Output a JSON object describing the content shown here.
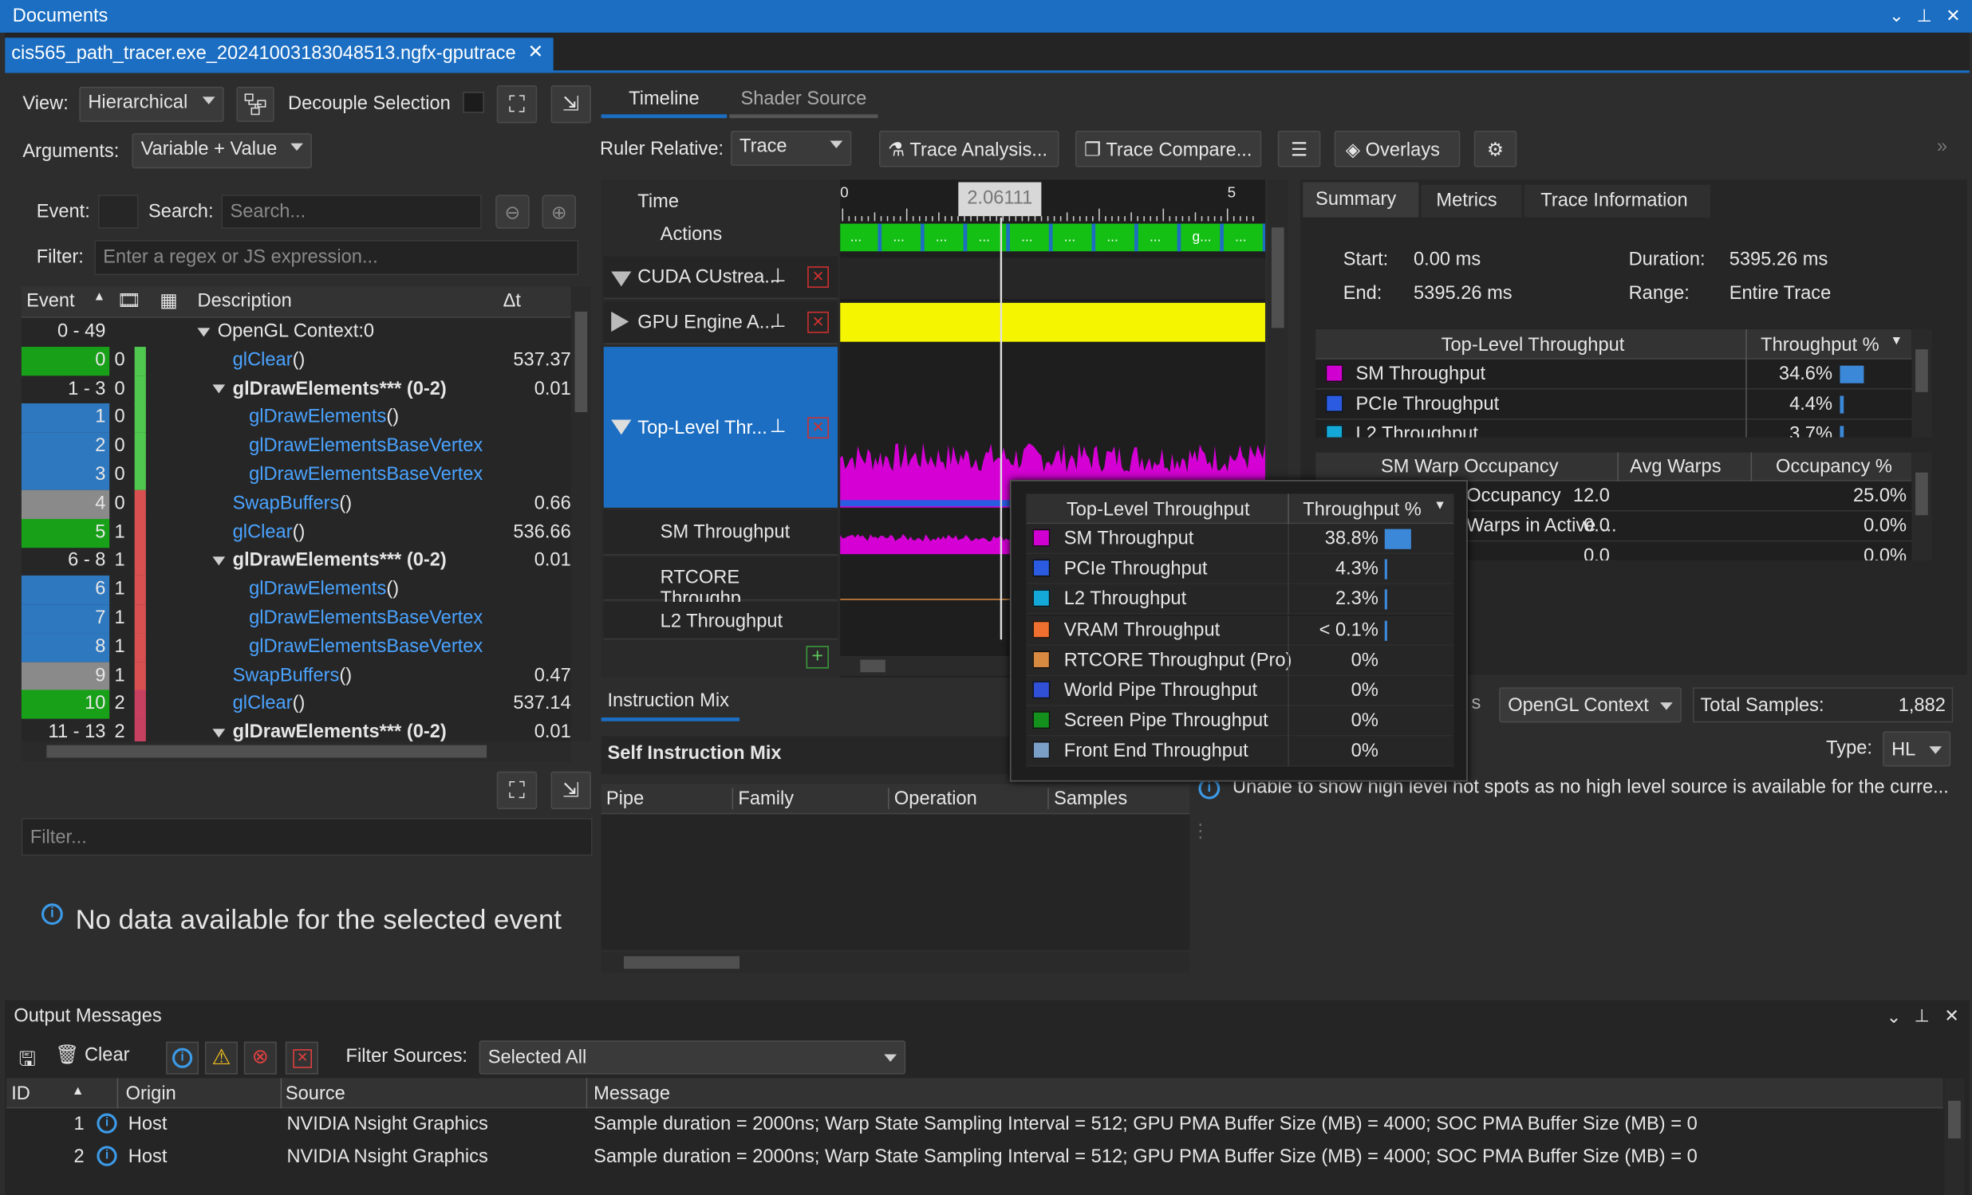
{
  "window": {
    "title": "Documents",
    "doc_tab": "cis565_path_tracer.exe_20241003183048513.ngfx-gputrace"
  },
  "left": {
    "view_label": "View:",
    "view_value": "Hierarchical",
    "decouple_label": "Decouple Selection",
    "arguments_label": "Arguments:",
    "arguments_value": "Variable + Value",
    "event_label": "Event:",
    "search_label": "Search:",
    "search_placeholder": "Search...",
    "filter_label": "Filter:",
    "filter_placeholder": "Enter a regex or JS expression...",
    "columns": {
      "event": "Event",
      "description": "Description",
      "delta": "Δt"
    },
    "rows": [
      {
        "ev": "0 - 49",
        "d": "",
        "desc": "OpenGL Context:0",
        "dt": "",
        "kind": "group0"
      },
      {
        "ev": "0",
        "d": "0",
        "desc": "glClear",
        "paren": "()",
        "dt": "537.37",
        "kind": "green"
      },
      {
        "ev": "1 - 3",
        "d": "0",
        "desc": "glDrawElements*** (0-2)",
        "dt": "0.01",
        "kind": "group"
      },
      {
        "ev": "1",
        "d": "0",
        "desc": "glDrawElements",
        "paren": "()",
        "dt": "",
        "kind": "blue"
      },
      {
        "ev": "2",
        "d": "0",
        "desc": "glDrawElementsBaseVertex",
        "dt": "",
        "kind": "blue"
      },
      {
        "ev": "3",
        "d": "0",
        "desc": "glDrawElementsBaseVertex",
        "dt": "",
        "kind": "blue"
      },
      {
        "ev": "4",
        "d": "0",
        "desc": "SwapBuffers",
        "paren": "()",
        "dt": "0.66",
        "kind": "gray"
      },
      {
        "ev": "5",
        "d": "1",
        "desc": "glClear",
        "paren": "()",
        "dt": "536.66",
        "kind": "green"
      },
      {
        "ev": "6 - 8",
        "d": "1",
        "desc": "glDrawElements*** (0-2)",
        "dt": "0.01",
        "kind": "group"
      },
      {
        "ev": "6",
        "d": "1",
        "desc": "glDrawElements",
        "paren": "()",
        "dt": "",
        "kind": "blue"
      },
      {
        "ev": "7",
        "d": "1",
        "desc": "glDrawElementsBaseVertex",
        "dt": "",
        "kind": "blue"
      },
      {
        "ev": "8",
        "d": "1",
        "desc": "glDrawElementsBaseVertex",
        "dt": "",
        "kind": "blue"
      },
      {
        "ev": "9",
        "d": "1",
        "desc": "SwapBuffers",
        "paren": "()",
        "dt": "0.47",
        "kind": "gray"
      },
      {
        "ev": "10",
        "d": "2",
        "desc": "glClear",
        "paren": "()",
        "dt": "537.14",
        "kind": "green"
      },
      {
        "ev": "11 - 13",
        "d": "2",
        "desc": "glDrawElements*** (0-2)",
        "dt": "0.01",
        "kind": "group"
      }
    ],
    "filter2_placeholder": "Filter...",
    "no_data": "No data available for the selected event"
  },
  "timeline": {
    "tabs": [
      "Timeline",
      "Shader Source"
    ],
    "ruler_label": "Ruler Relative:",
    "ruler_value": "Trace",
    "trace_analysis": "Trace Analysis...",
    "trace_compare": "Trace Compare...",
    "overlays": "Overlays",
    "time_label": "Time",
    "actions_label": "Actions",
    "tick_start": "0",
    "tick_end": "5",
    "cursor": "2.06111",
    "action_marks": [
      "...",
      "...",
      "...",
      "...",
      "...",
      "...",
      "...",
      "...",
      "g...",
      "..."
    ],
    "tracks": [
      "CUDA CUstrea...",
      "GPU Engine A...",
      "Top-Level Thr...",
      "SM Throughput",
      "RTCORE Throughp...",
      "L2 Throughput"
    ]
  },
  "instruction": {
    "tab": "Instruction Mix",
    "title": "Self Instruction Mix",
    "columns": [
      "Pipe",
      "Family",
      "Operation",
      "Samples"
    ]
  },
  "summary": {
    "tabs": [
      "Summary",
      "Metrics",
      "Trace Information"
    ],
    "start_label": "Start:",
    "start": "0.00 ms",
    "duration_label": "Duration:",
    "duration": "5395.26 ms",
    "end_label": "End:",
    "end": "5395.26 ms",
    "range_label": "Range:",
    "range": "Entire Trace",
    "throughput_header": [
      "Top-Level Throughput",
      "Throughput %"
    ],
    "throughput_rows": [
      {
        "name": "SM Throughput",
        "value": "34.6%",
        "color": "#d000d0",
        "bar": 34.6
      },
      {
        "name": "PCIe Throughput",
        "value": "4.4%",
        "color": "#2a5be0",
        "bar": 4.4
      },
      {
        "name": "L2 Throughput",
        "value": "3.7%",
        "color": "#14a8d8",
        "bar": 3.7
      }
    ],
    "warp_header": [
      "SM Warp Occupancy",
      "Avg Warps",
      "Occupancy %"
    ],
    "warp_rows": [
      {
        "name": "Occupancy",
        "avg": "12.0",
        "pct": "25.0%"
      },
      {
        "name": "Warps in Active ...",
        "avg": "0.0",
        "pct": "0.0%"
      },
      {
        "name": "",
        "avg": "0.0",
        "pct": "0.0%"
      }
    ],
    "context_suffix": "s",
    "context_value": "OpenGL Context",
    "total_samples_label": "Total Samples:",
    "total_samples": "1,882",
    "type_label": "Type:",
    "type_value": "HL",
    "hotspot_msg": "Unable to show high level hot spots as no high level source is available for the curre..."
  },
  "popup": {
    "header": [
      "Top-Level Throughput",
      "Throughput %"
    ],
    "rows": [
      {
        "name": "SM Throughput",
        "value": "38.8%",
        "color": "#d000d0",
        "bar": 38.8
      },
      {
        "name": "PCIe Throughput",
        "value": "4.3%",
        "color": "#2a5be0",
        "bar": 4.3
      },
      {
        "name": "L2 Throughput",
        "value": "2.3%",
        "color": "#14a8d8",
        "bar": 2.3
      },
      {
        "name": "VRAM Throughput",
        "value": "< 0.1%",
        "color": "#f07030",
        "bar": 0.1
      },
      {
        "name": "RTCORE Throughput (Pro)",
        "value": "0%",
        "color": "#d88a40",
        "bar": 0
      },
      {
        "name": "World Pipe Throughput",
        "value": "0%",
        "color": "#3050d8",
        "bar": 0
      },
      {
        "name": "Screen Pipe Throughput",
        "value": "0%",
        "color": "#14901c",
        "bar": 0
      },
      {
        "name": "Front End Throughput",
        "value": "0%",
        "color": "#7aa0c8",
        "bar": 0
      }
    ]
  },
  "output": {
    "title": "Output Messages",
    "clear": "Clear",
    "filter_label": "Filter Sources:",
    "filter_value": "Selected All",
    "columns": [
      "ID",
      "Origin",
      "Source",
      "Message"
    ],
    "rows": [
      {
        "id": "1",
        "origin": "Host",
        "source": "NVIDIA Nsight Graphics",
        "message": "Sample duration = 2000ns; Warp State Sampling Interval = 512; GPU PMA Buffer Size (MB) = 4000; SOC PMA Buffer Size (MB) = 0"
      },
      {
        "id": "2",
        "origin": "Host",
        "source": "NVIDIA Nsight Graphics",
        "message": "Sample duration = 2000ns; Warp State Sampling Interval = 512; GPU PMA Buffer Size (MB) = 4000; SOC PMA Buffer Size (MB) = 0"
      }
    ]
  },
  "colors": {
    "accent": "#1b6ec2",
    "green": "#10a010",
    "blue": "#2e78c0",
    "yellow": "#f5f500",
    "magenta": "#d400d4"
  }
}
